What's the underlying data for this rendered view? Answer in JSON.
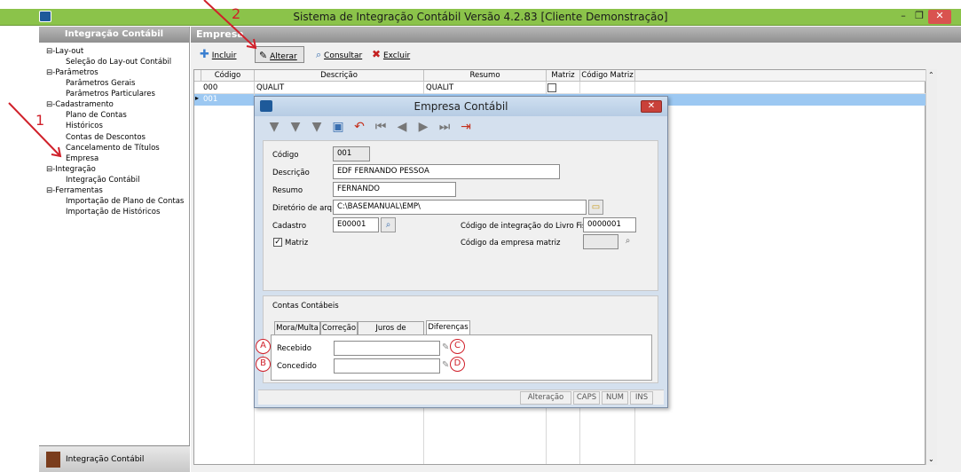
{
  "window": {
    "title": "Sistema de Integração Contábil Versão 4.2.83 [Cliente Demonstração]",
    "min": "–",
    "max": "❐",
    "close": "✕"
  },
  "sidebar": {
    "header": "Integração Contábil",
    "tree": [
      {
        "label": "⊟-Lay-out"
      },
      {
        "label": "Seleção do Lay-out Contábil"
      },
      {
        "label": "⊟-Parâmetros"
      },
      {
        "label": "Parâmetros Gerais"
      },
      {
        "label": "Parâmetros Particulares"
      },
      {
        "label": "⊟-Cadastramento"
      },
      {
        "label": "Plano de Contas"
      },
      {
        "label": "Históricos"
      },
      {
        "label": "Contas de Descontos"
      },
      {
        "label": "Cancelamento de Títulos"
      },
      {
        "label": "Empresa"
      },
      {
        "label": "⊟-Integração"
      },
      {
        "label": "Integração Contábil"
      },
      {
        "label": "⊟-Ferramentas"
      },
      {
        "label": "Importação de Plano de Contas"
      },
      {
        "label": "Importação de Históricos"
      }
    ],
    "footer": "Integração Contábil"
  },
  "main": {
    "header": "Empresa",
    "toolbar": {
      "incluir": "Incluir",
      "alterar": "Alterar",
      "consultar": "Consultar",
      "excluir": "Excluir"
    },
    "grid": {
      "columns": [
        "Código",
        "Descrição",
        "Resumo",
        "Matriz",
        "Código Matriz"
      ],
      "rows": [
        {
          "codigo": "000",
          "descricao": "QUALIT",
          "resumo": "QUALIT",
          "matriz": false,
          "codigo_matriz": ""
        },
        {
          "codigo": "001",
          "descricao": "",
          "resumo": "",
          "matriz": true,
          "codigo_matriz": ""
        }
      ]
    }
  },
  "dialog": {
    "title": "Empresa Contábil",
    "fields": {
      "codigo_label": "Código",
      "codigo": "001",
      "descricao_label": "Descrição",
      "descricao": "EDF FERNANDO PESSOA",
      "resumo_label": "Resumo",
      "resumo": "FERNANDO",
      "diretorio_label": "Diretório de arq.",
      "diretorio": "C:\\BASEMANUAL\\EMP\\",
      "cadastro_label": "Cadastro",
      "cadastro": "E00001",
      "livro_label": "Código de integração do Livro Fiscal",
      "livro": "0000001",
      "matriz_label": "Matriz",
      "matriz": true,
      "emp_matriz_label": "Código da empresa matriz",
      "emp_matriz": ""
    },
    "contas": {
      "title": "Contas Contábeis",
      "tabs": [
        "Mora/Multa",
        "Correção",
        "Juros de Contrato",
        "Diferenças"
      ],
      "selected_tab": "Diferenças",
      "recebido_label": "Recebido",
      "concedido_label": "Concedido"
    },
    "status": {
      "mode": "Alteração",
      "caps": "CAPS",
      "num": "NUM",
      "ins": "INS"
    }
  },
  "annotations": {
    "a": "A",
    "b": "B",
    "c": "C",
    "d": "D",
    "one": "1",
    "two": "2"
  }
}
